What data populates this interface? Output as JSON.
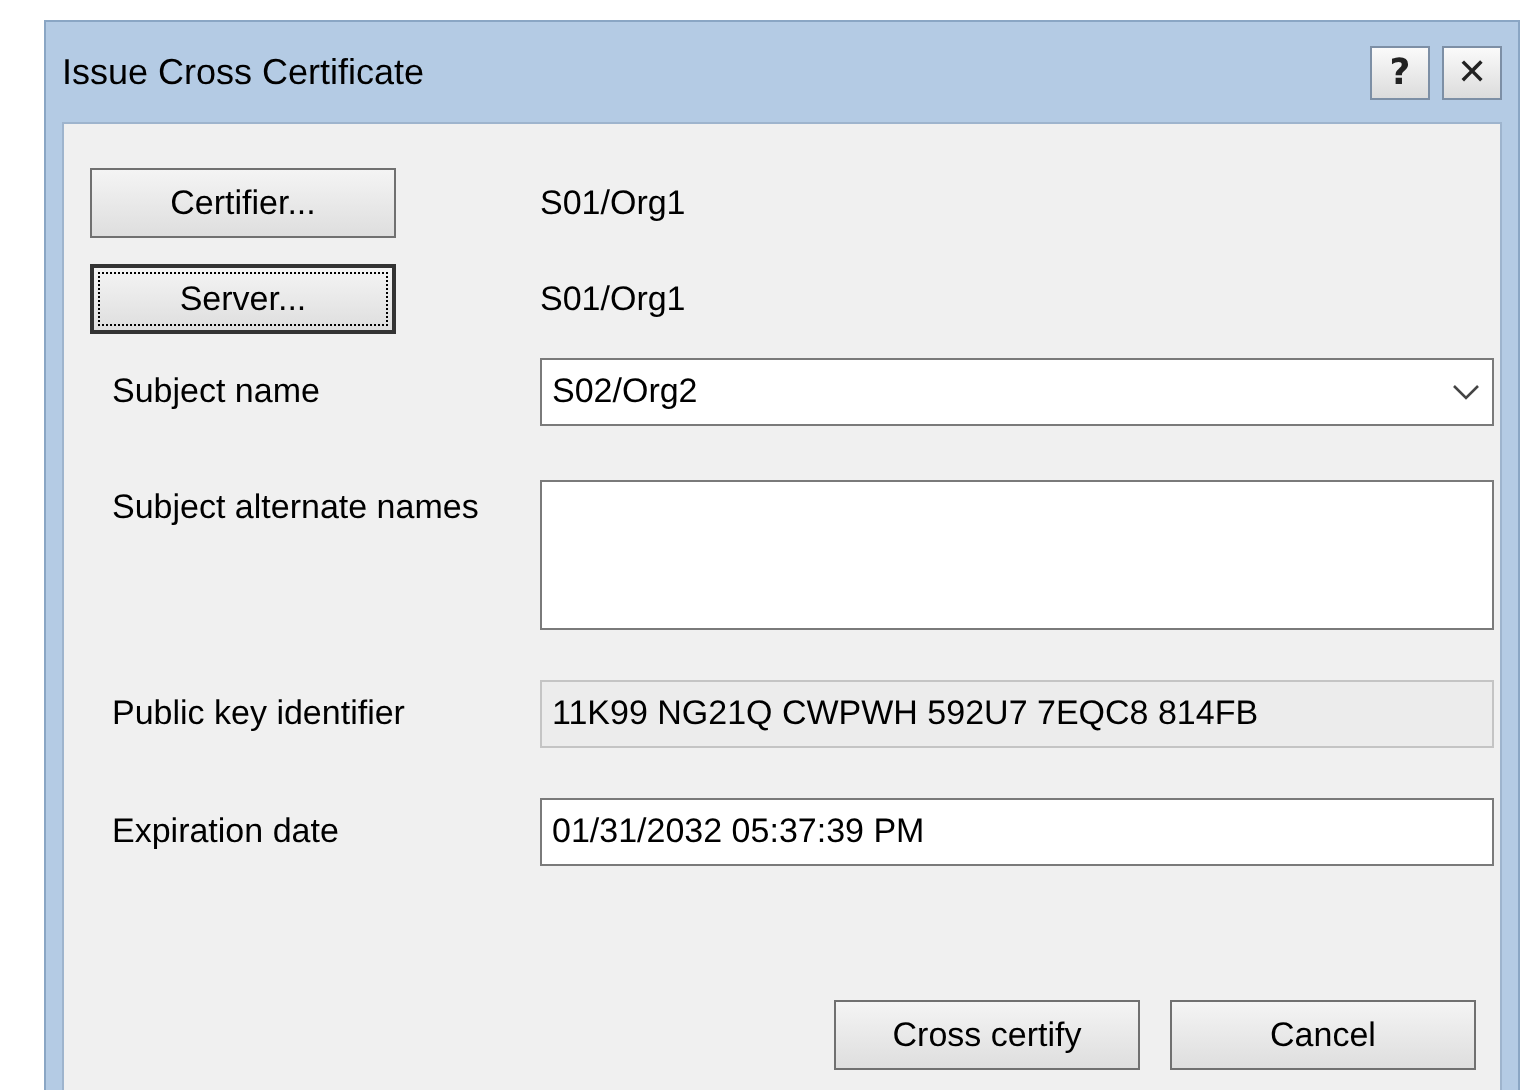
{
  "window": {
    "title": "Issue Cross Certificate",
    "help_button": "?",
    "close_button": "✕"
  },
  "pickers": [
    {
      "label": "Certifier...",
      "value": "S01/Org1",
      "focused": false
    },
    {
      "label": "Server...",
      "value": "S01/Org1",
      "focused": true
    }
  ],
  "fields": [
    {
      "kind": "combo",
      "label": "Subject name",
      "value": "S02/Org2",
      "disabled": false
    },
    {
      "kind": "textarea",
      "label": "Subject alternate names",
      "disabled": false
    },
    {
      "kind": "text",
      "label": "Public key identifier",
      "value": "11K99 NG21Q CWPWH 592U7 7EQC8 814FB",
      "disabled": true
    },
    {
      "kind": "text",
      "label": "Expiration date",
      "value": "01/31/2032 05:37:39 PM",
      "disabled": false
    }
  ],
  "buttons": [
    {
      "label": "Cross certify"
    },
    {
      "label": "Cancel"
    }
  ]
}
